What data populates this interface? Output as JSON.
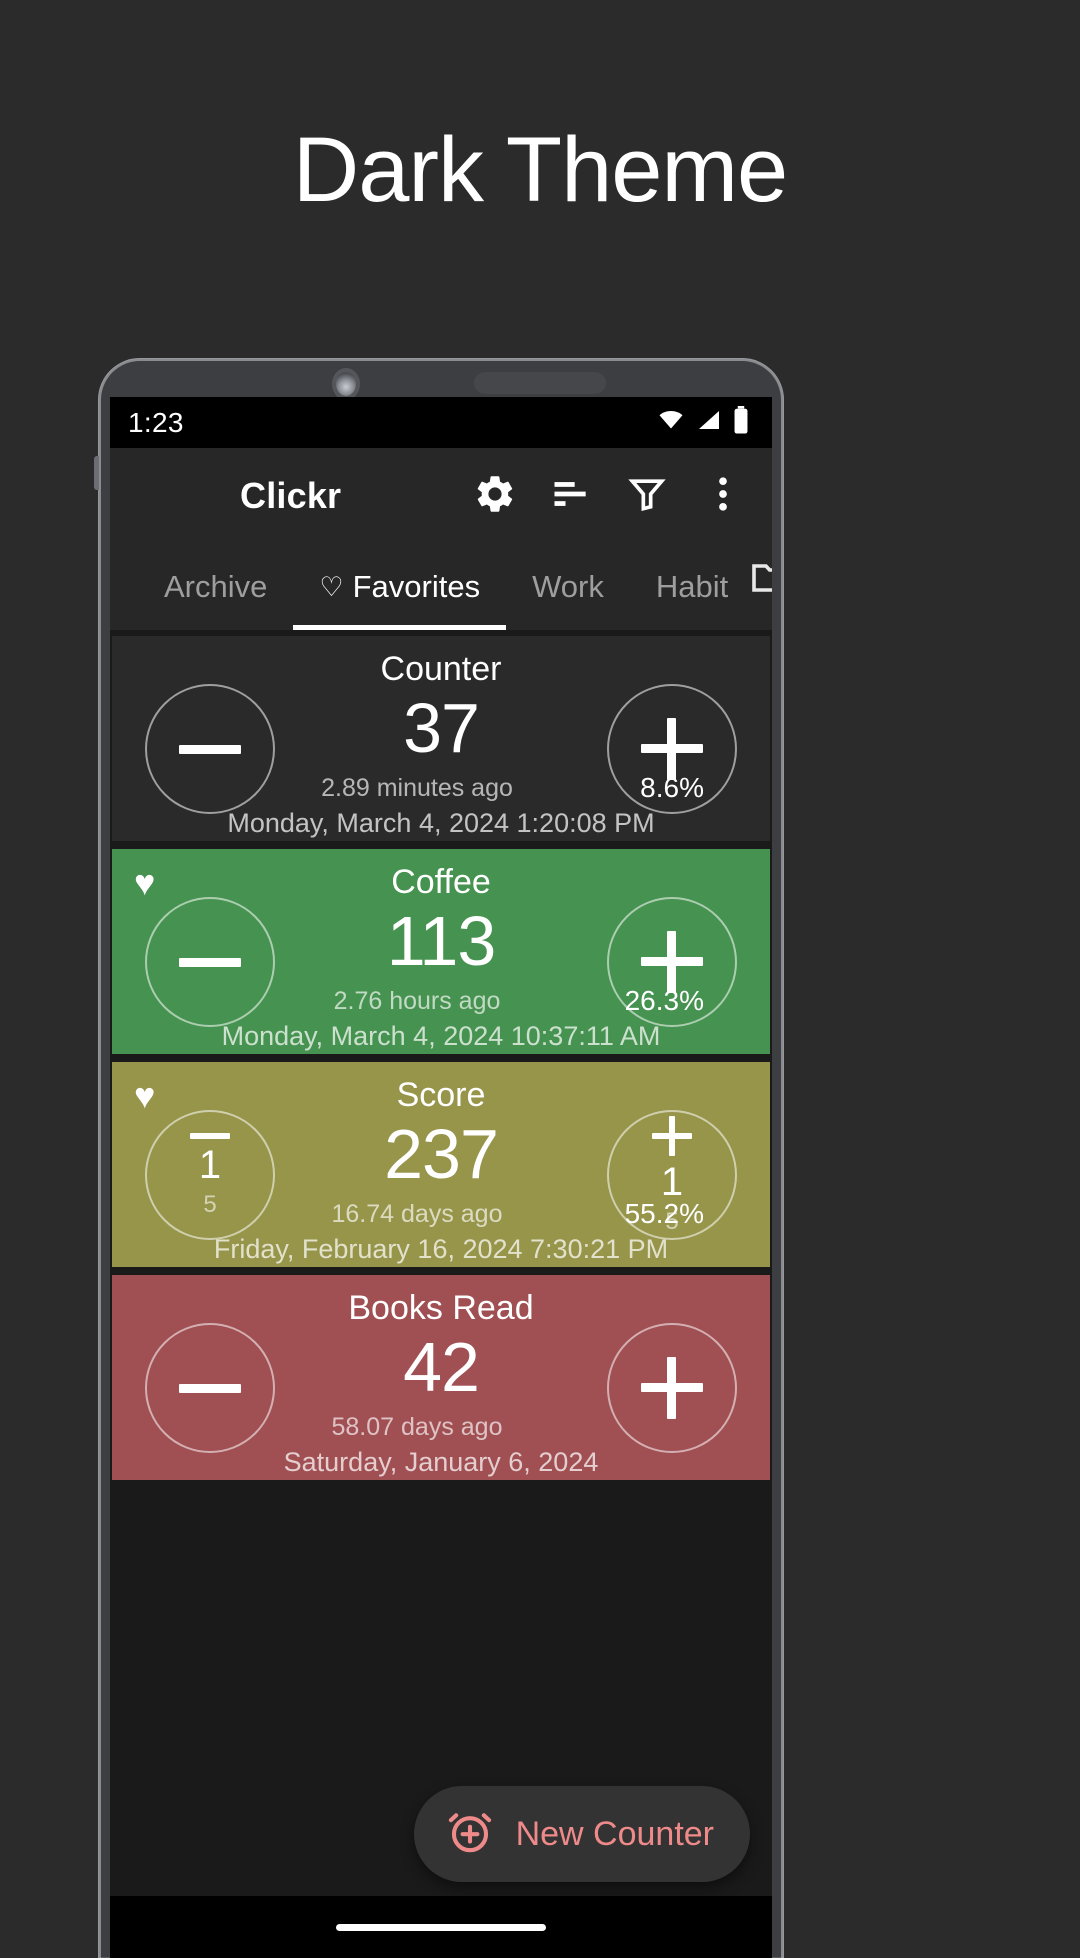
{
  "promo": {
    "title": "Dark Theme"
  },
  "status_bar": {
    "time": "1:23",
    "icons": [
      "wifi-icon",
      "cellular-signal-icon",
      "battery-icon"
    ]
  },
  "app_bar": {
    "title": "Clickr",
    "actions": [
      {
        "name": "settings-button",
        "icon": "gear-icon"
      },
      {
        "name": "sort-button",
        "icon": "sort-icon"
      },
      {
        "name": "filter-button",
        "icon": "funnel-icon"
      },
      {
        "name": "overflow-menu-button",
        "icon": "more-vertical-icon"
      }
    ]
  },
  "tabs": {
    "items": [
      {
        "label": "Archive",
        "selected": false,
        "heart": ""
      },
      {
        "label": "Favorites",
        "selected": true,
        "heart": "♡"
      },
      {
        "label": "Work",
        "selected": false,
        "heart": ""
      },
      {
        "label": "Habit",
        "selected": false,
        "heart": ""
      }
    ],
    "folder_icon": "folder-icon"
  },
  "counters": [
    {
      "title": "Counter",
      "value": "37",
      "elapsed": "2.89 minutes ago",
      "percent": "8.6%",
      "date": "Monday, March 4, 2024 1:20:08 PM",
      "favorite": false,
      "color": "#2a2a2a",
      "step_label": "",
      "step_sub": ""
    },
    {
      "title": "Coffee",
      "value": "113",
      "elapsed": "2.76 hours ago",
      "percent": "26.3%",
      "date": "Monday, March 4, 2024 10:37:11 AM",
      "favorite": true,
      "color": "#469250",
      "step_label": "",
      "step_sub": ""
    },
    {
      "title": "Score",
      "value": "237",
      "elapsed": "16.74 days ago",
      "percent": "55.2%",
      "date": "Friday, February 16, 2024 7:30:21 PM",
      "favorite": true,
      "color": "#97954a",
      "step_label": "1",
      "step_sub": "5"
    },
    {
      "title": "Books Read",
      "value": "42",
      "elapsed": "58.07 days ago",
      "percent": "",
      "date": "Saturday, January 6, 2024",
      "favorite": false,
      "color": "#a04f53",
      "step_label": "",
      "step_sub": ""
    }
  ],
  "fab": {
    "label": "New Counter",
    "icon": "alarm-plus-icon",
    "accent": "#ef8a8a"
  },
  "nav_bar": {
    "pill": "home-gesture-pill"
  }
}
